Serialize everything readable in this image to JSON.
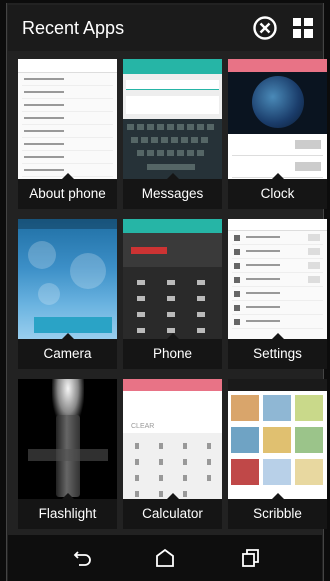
{
  "header": {
    "title": "Recent Apps",
    "close_icon": "close-circle-icon",
    "grid_icon": "grid-view-icon"
  },
  "apps": [
    {
      "label": "About phone",
      "icon": "about-phone-thumbnail"
    },
    {
      "label": "Messages",
      "icon": "messages-thumbnail"
    },
    {
      "label": "Clock",
      "icon": "clock-thumbnail"
    },
    {
      "label": "Camera",
      "icon": "camera-thumbnail"
    },
    {
      "label": "Phone",
      "icon": "phone-thumbnail"
    },
    {
      "label": "Settings",
      "icon": "settings-thumbnail"
    },
    {
      "label": "Flashlight",
      "icon": "flashlight-thumbnail"
    },
    {
      "label": "Calculator",
      "icon": "calculator-thumbnail"
    },
    {
      "label": "Scribble",
      "icon": "scribble-thumbnail"
    }
  ],
  "calculator": {
    "display_text": "CLEAR"
  },
  "navbar": {
    "back_icon": "back-icon",
    "home_icon": "home-icon",
    "recents_icon": "recents-icon"
  },
  "colors": {
    "background": "#222222",
    "header": "#1b1b1b",
    "label_bar": "#151515",
    "messages_accent": "#26b5a6",
    "clock_accent": "#e87386"
  }
}
